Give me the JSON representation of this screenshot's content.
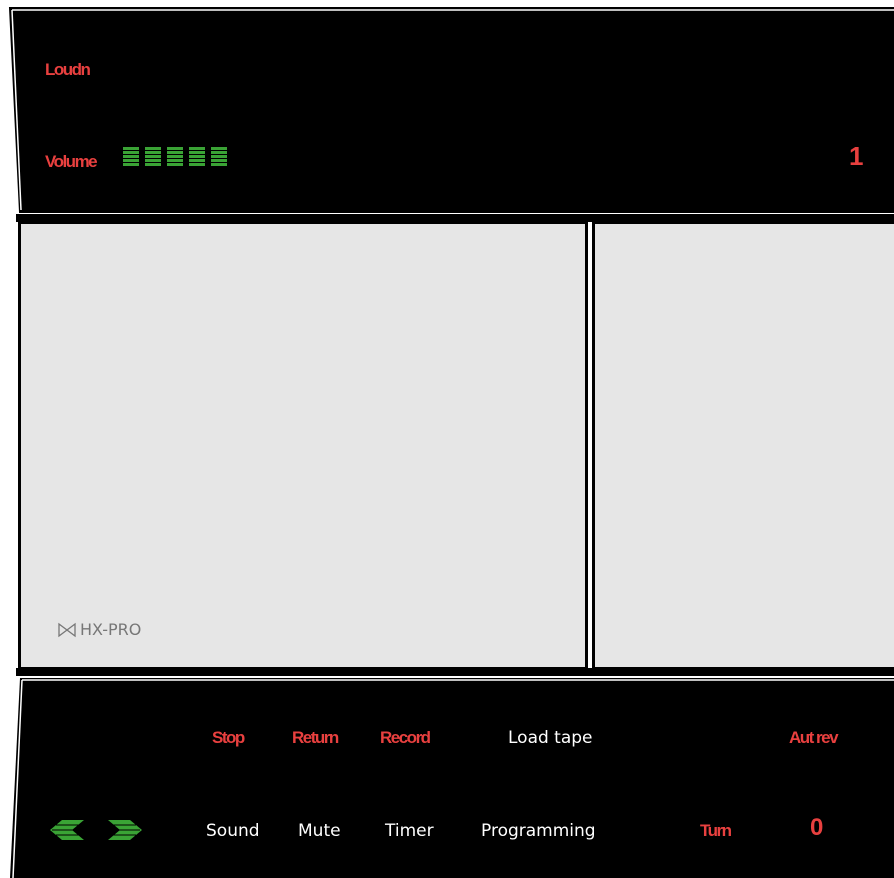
{
  "display": {
    "loudness_label": "Loudn",
    "volume_label": "Volume",
    "volume_level_segments": 5,
    "channel_number": "1"
  },
  "cassette": {
    "logo_text": "HX-PRO"
  },
  "controls": {
    "stop_label": "Stop",
    "return_label": "Return",
    "record_label": "Record",
    "load_tape_label": "Load tape",
    "auto_reverse_label": "Aut rev",
    "sound_label": "Sound",
    "mute_label": "Mute",
    "timer_label": "Timer",
    "programming_label": "Programming",
    "turn_label": "Turn",
    "counter_value": "0"
  },
  "colors": {
    "panel_background": "#000000",
    "label_red": "#e8403f",
    "meter_green": "#3aa335",
    "window_gray": "#e6e6e6"
  }
}
